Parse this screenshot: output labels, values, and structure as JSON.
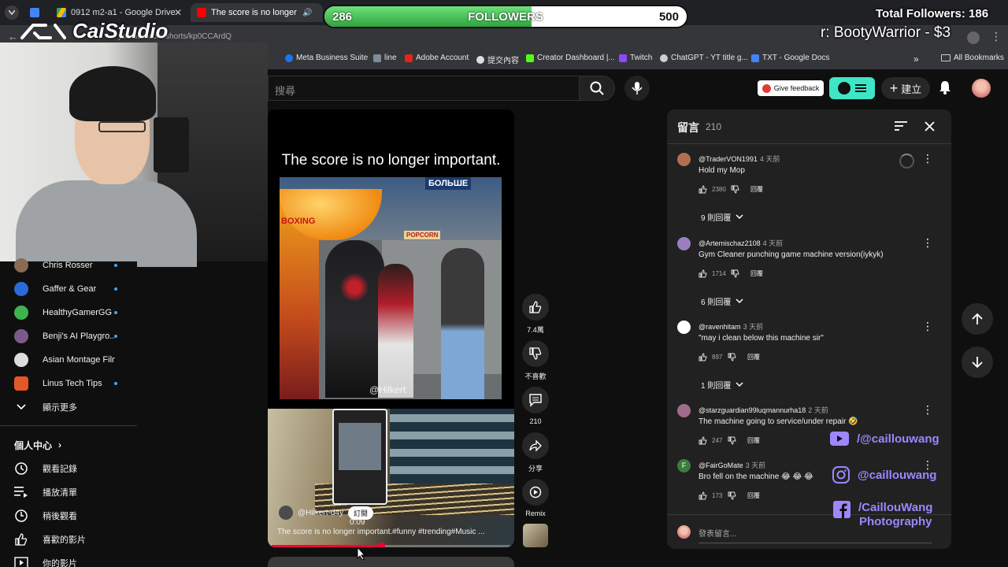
{
  "browser": {
    "tabs": [
      {
        "label": "",
        "color": "#4285f4"
      },
      {
        "label": "0912 m2-a1 - Google Drive",
        "color": "#34a853"
      },
      {
        "label": "The score is no longer impo",
        "color": "#ff0000"
      }
    ],
    "url": "youtube.com/shorts/kp0CCArdQ",
    "bookmarks": [
      "Meta Business Suite",
      "line",
      "Adobe Account",
      "提交內容",
      "Creator Dashboard |...",
      "Twitch",
      "ChatGPT - YT title g...",
      "TXT - Google Docs"
    ],
    "all_bookmarks": "All Bookmarks",
    "more": "»"
  },
  "youtube_header": {
    "search_placeholder": "搜尋",
    "feedback_label": "Give feedback",
    "create_label": "建立"
  },
  "sidebar": {
    "subscriptions": [
      {
        "name": "Chris Rosser",
        "color": "#8a6a55"
      },
      {
        "name": "Gaffer & Gear",
        "color": "#2a6bd8"
      },
      {
        "name": "HealthyGamerGG",
        "color": "#3fb34f"
      },
      {
        "name": "Benji's AI Playgro...",
        "color": "#7a5a8c"
      },
      {
        "name": "Asian Montage Film",
        "color": "#dddddd"
      },
      {
        "name": "Linus Tech Tips",
        "color": "#e4562a"
      }
    ],
    "show_more": "顯示更多",
    "you_section": "個人中心",
    "you_items": [
      "觀看記錄",
      "播放清單",
      "稍後觀看",
      "喜歡的影片",
      "你的影片"
    ]
  },
  "short": {
    "caption": "The score is no longer important.",
    "watermark": "@Hilkert",
    "channel": "@Hilkert-d4y",
    "subscribe": "訂閱",
    "title": "The score is no longer important.#funny  #trending#Music ...",
    "time": "0:09",
    "progress": 0.46,
    "scene_text_sign": "БОЛЬШЕ",
    "scene_text_boxing": "BOXING",
    "scene_text_popcorn": "POPCORN"
  },
  "actions": {
    "likes": "7.4萬",
    "dislike": "不喜歡",
    "comments": "210",
    "share": "分享",
    "remix": "Remix"
  },
  "comments_panel": {
    "title": "留言",
    "count": "210",
    "add_placeholder": "發表留言...",
    "items": [
      {
        "user": "@TraderVON1991",
        "time": "4 天前",
        "text": "Hold my Mop",
        "likes": "2380",
        "reply": "回覆",
        "replies": "9 則回覆",
        "avatar": "#b07050"
      },
      {
        "user": "@Artemischaz2108",
        "time": "4 天前",
        "text": "Gym Cleaner punching game machine version(iykyk)",
        "likes": "1714",
        "reply": "回覆",
        "replies": "6 則回覆",
        "avatar": "#9a7ec0"
      },
      {
        "user": "@ravenhitam",
        "time": "3 天前",
        "text": "\"may i clean below this machine sir\"",
        "likes": "897",
        "reply": "回覆",
        "replies": "1 則回覆",
        "avatar": "#ffffff"
      },
      {
        "user": "@starzguardian99luqmannurha18",
        "time": "2 天前",
        "text": "The machine going to service/under repair 🤣",
        "likes": "247",
        "reply": "回覆",
        "replies": "",
        "avatar": "#a06c8a"
      },
      {
        "user": "@FairGoMate",
        "time": "3 天前",
        "text": "Bro fell on the machine 😂 😂 😂",
        "likes": "173",
        "reply": "回覆",
        "replies": "",
        "avatar": "#3b7d3b",
        "initial": "F"
      }
    ]
  },
  "stream_overlay": {
    "logo": "CaiStudio",
    "followers_label": "FOLLOWERS",
    "followers_current": "286",
    "followers_goal": "500",
    "followers_fraction": 0.572,
    "total_followers": "Total Followers: 186",
    "donation": "r: BootyWarrior - $3",
    "youtube_handle": "/@caillouwang",
    "instagram_handle": "@caillouwang",
    "facebook_handle_1": "/CaillouWang",
    "facebook_handle_2": "Photography"
  }
}
